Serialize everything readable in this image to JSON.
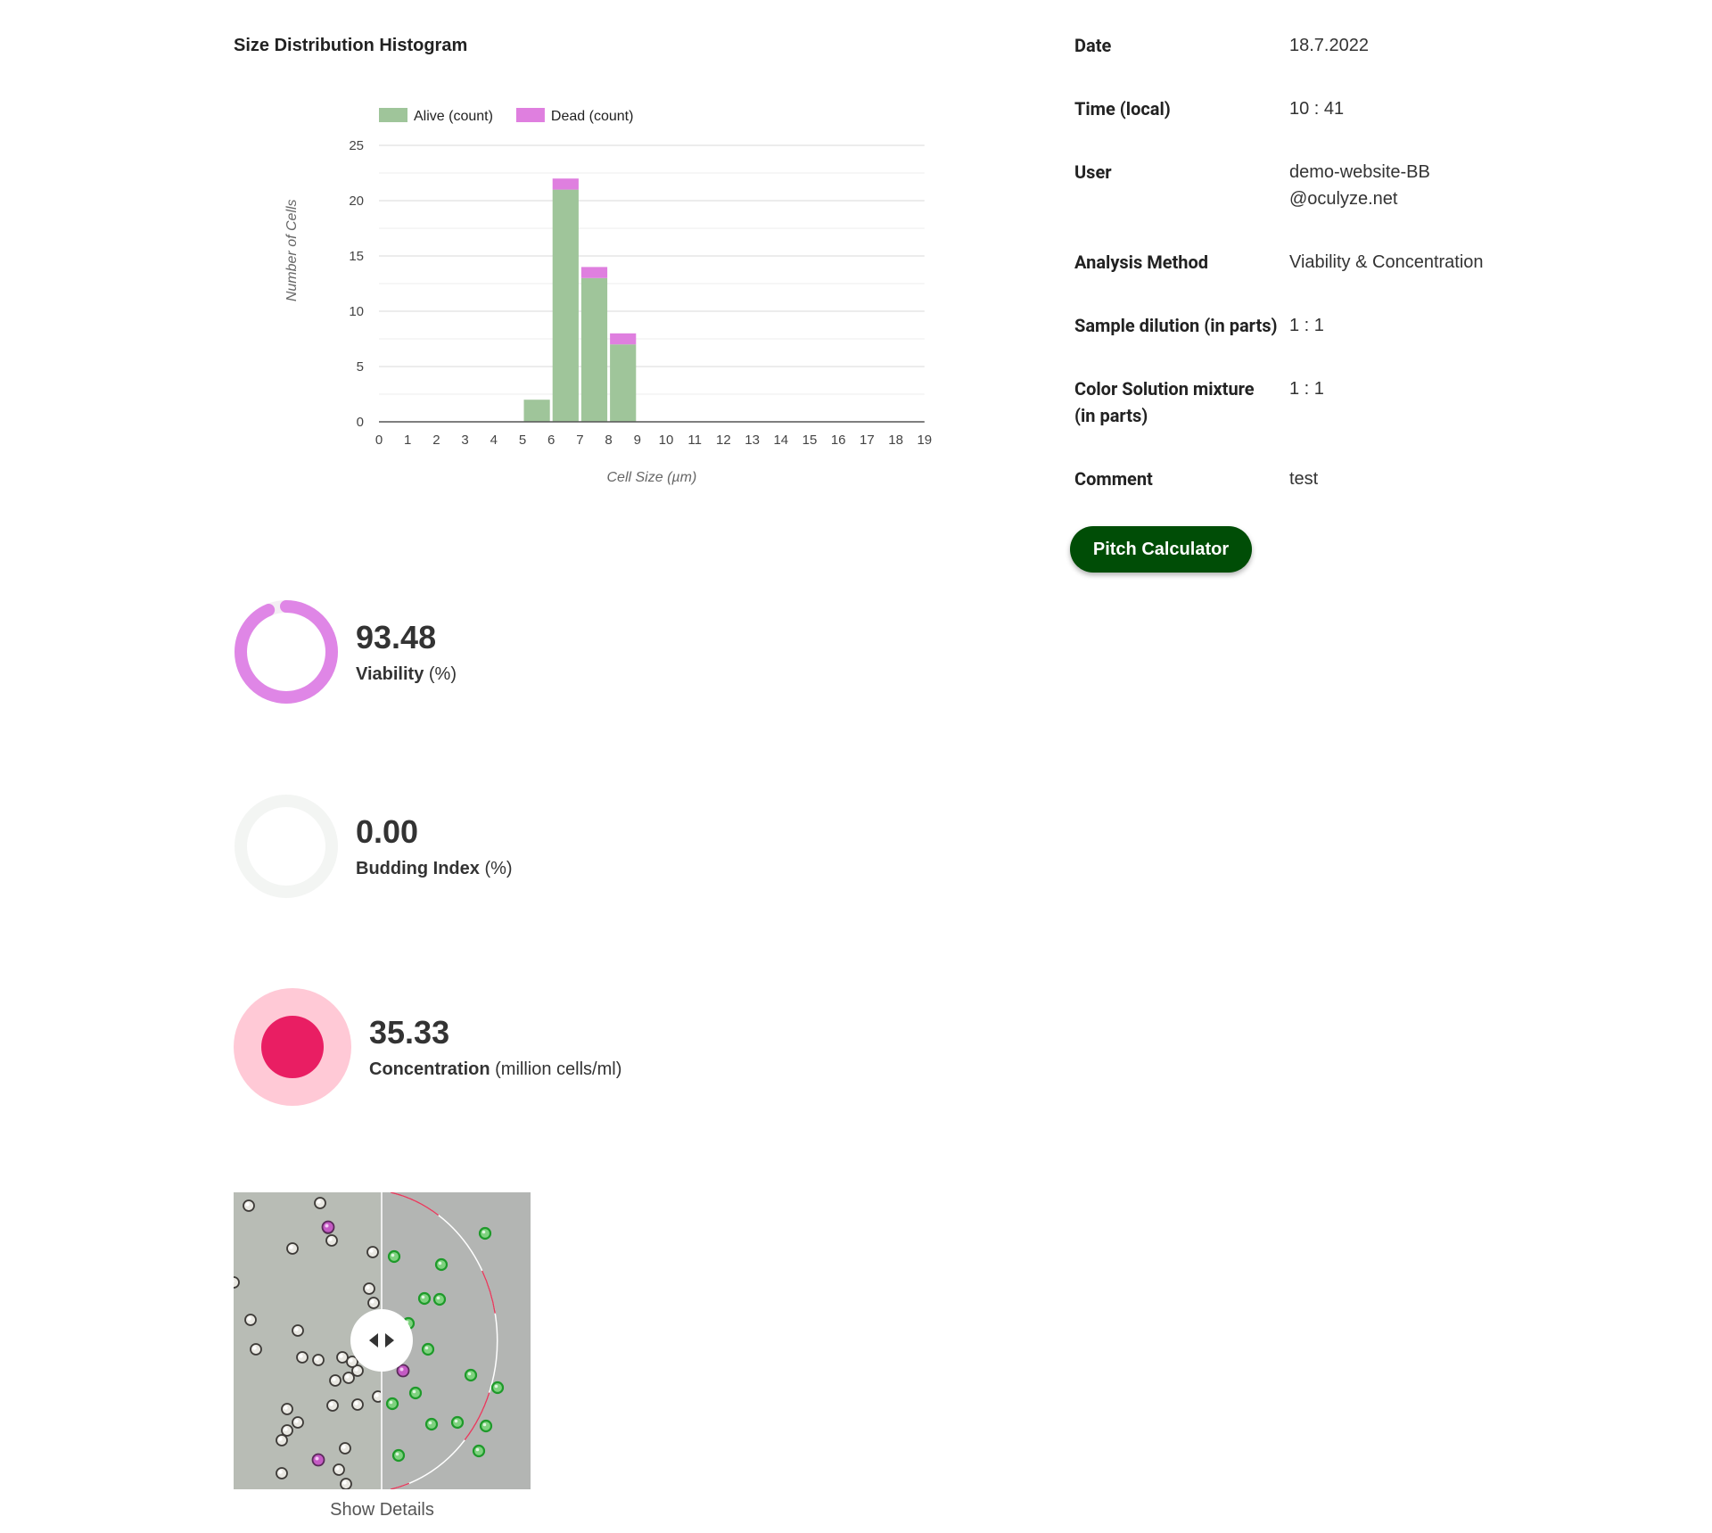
{
  "histogram": {
    "heading": "Size Distribution Histogram"
  },
  "chart_data": {
    "type": "bar",
    "stacked": true,
    "categories": [
      "0",
      "1",
      "2",
      "3",
      "4",
      "5",
      "6",
      "7",
      "8",
      "9",
      "10",
      "11",
      "12",
      "13",
      "14",
      "15",
      "16",
      "17",
      "18",
      "19"
    ],
    "series": [
      {
        "name": "Alive (count)",
        "color": "#9fc59a",
        "values": [
          0,
          0,
          0,
          0,
          0,
          2,
          21,
          13,
          7,
          0,
          0,
          0,
          0,
          0,
          0,
          0,
          0,
          0,
          0,
          0
        ]
      },
      {
        "name": "Dead (count)",
        "color": "#df7fdf",
        "values": [
          0,
          0,
          0,
          0,
          0,
          0,
          1,
          1,
          1,
          0,
          0,
          0,
          0,
          0,
          0,
          0,
          0,
          0,
          0,
          0
        ]
      }
    ],
    "xlabel": "Cell Size (µm)",
    "ylabel": "Number of Cells",
    "ylim": [
      0,
      25
    ],
    "yticks": [
      0,
      5,
      10,
      15,
      20,
      25
    ],
    "grid": true,
    "legend": "top-left"
  },
  "info": [
    {
      "label": "Date",
      "value": "18.7.2022"
    },
    {
      "label": "Time (local)",
      "value": "10 : 41"
    },
    {
      "label": "User",
      "value": "demo-website-BB@oculyze.net"
    },
    {
      "label": "Analysis Method",
      "value": "Viability & Concentration"
    },
    {
      "label": "Sample dilution (in parts)",
      "value": "1 : 1"
    },
    {
      "label": "Color Solution mixture (in parts)",
      "value": "1 : 1"
    },
    {
      "label": "Comment",
      "value": "test"
    }
  ],
  "pitch_button": "Pitch Calculator",
  "metrics": {
    "viability": {
      "value": "93.48",
      "name": "Viability",
      "unit": "(%)",
      "ring_fraction": 0.9348,
      "color": "#df86e6"
    },
    "budding": {
      "value": "0.00",
      "name": "Budding Index",
      "unit": "(%)",
      "ring_fraction": 0,
      "color": "#f3f5f3"
    },
    "concentration": {
      "value": "35.33",
      "name": "Concentration",
      "unit": "(million cells/ml)",
      "color": "#e91e63",
      "halo_color": "#ffc9d6"
    }
  },
  "micrograph": {
    "show_details": "Show Details"
  }
}
